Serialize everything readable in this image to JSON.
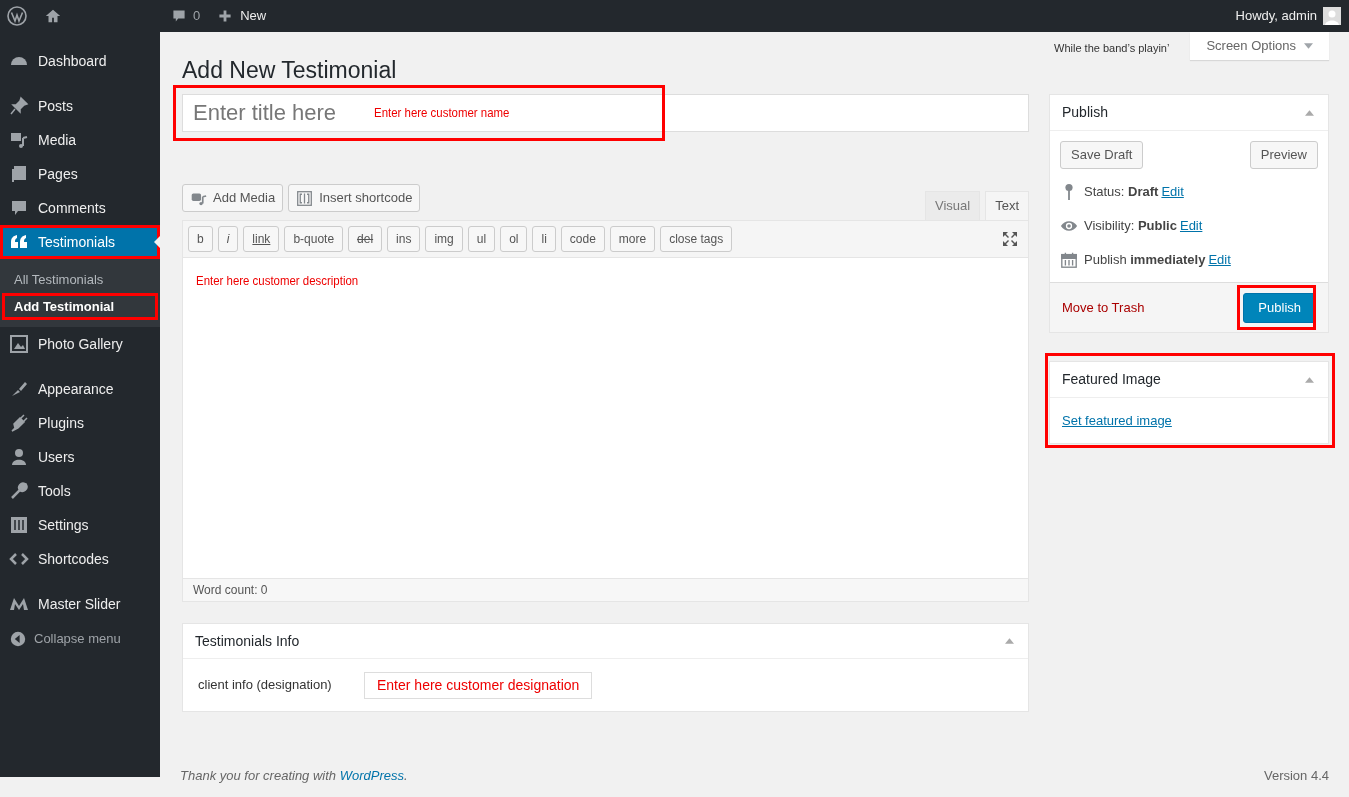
{
  "admin_bar": {
    "comments_count": "0",
    "new_label": "New",
    "greeting": "Howdy, admin"
  },
  "sidebar": {
    "groups": [
      [
        {
          "label": "Dashboard",
          "selected": false,
          "annotated": false
        }
      ],
      [
        {
          "label": "Posts",
          "selected": false,
          "annotated": false
        },
        {
          "label": "Media",
          "selected": false,
          "annotated": false
        },
        {
          "label": "Pages",
          "selected": false,
          "annotated": false
        },
        {
          "label": "Comments",
          "selected": false,
          "annotated": false
        },
        {
          "label": "Testimonials",
          "selected": true,
          "annotated": true,
          "children": [
            {
              "label": "All Testimonials",
              "selected": false,
              "annotated": false
            },
            {
              "label": "Add Testimonial",
              "selected": true,
              "annotated": true
            }
          ]
        },
        {
          "label": "Photo Gallery",
          "selected": false,
          "annotated": false
        }
      ],
      [
        {
          "label": "Appearance",
          "selected": false,
          "annotated": false
        },
        {
          "label": "Plugins",
          "selected": false,
          "annotated": false
        },
        {
          "label": "Users",
          "selected": false,
          "annotated": false
        },
        {
          "label": "Tools",
          "selected": false,
          "annotated": false
        },
        {
          "label": "Settings",
          "selected": false,
          "annotated": false
        },
        {
          "label": "Shortcodes",
          "selected": false,
          "annotated": false
        }
      ],
      [
        {
          "label": "Master Slider",
          "selected": false,
          "annotated": false
        }
      ]
    ],
    "collapse": "Collapse menu"
  },
  "header": {
    "tagline": "While the band’s playin’",
    "screen_options": "Screen Options",
    "page_title": "Add New Testimonial"
  },
  "title_field": {
    "placeholder": "Enter title here",
    "annotation": "Enter here customer name",
    "annotated": true
  },
  "media_buttons": [
    "Add Media",
    "Insert shortcode"
  ],
  "editor_tabs": [
    {
      "label": "Visual",
      "selected": false
    },
    {
      "label": "Text",
      "selected": true
    }
  ],
  "quicktags": [
    {
      "label": "b",
      "kind": "plain"
    },
    {
      "label": "i",
      "kind": "italic"
    },
    {
      "label": "link",
      "kind": "underline"
    },
    {
      "label": "b-quote",
      "kind": "plain"
    },
    {
      "label": "del",
      "kind": "strike"
    },
    {
      "label": "ins",
      "kind": "plain"
    },
    {
      "label": "img",
      "kind": "plain"
    },
    {
      "label": "ul",
      "kind": "plain"
    },
    {
      "label": "ol",
      "kind": "plain"
    },
    {
      "label": "li",
      "kind": "plain"
    },
    {
      "label": "code",
      "kind": "plain"
    },
    {
      "label": "more",
      "kind": "plain"
    },
    {
      "label": "close tags",
      "kind": "plain"
    }
  ],
  "editor": {
    "annotation": "Enter here customer description",
    "word_count": "Word count: 0"
  },
  "testimonials_info": {
    "title": "Testimonials Info",
    "field_label": "client info (designation)",
    "annotation": "Enter here customer designation"
  },
  "publish_box": {
    "title": "Publish",
    "save_draft": "Save Draft",
    "preview": "Preview",
    "rows": [
      "Status: **Draft**",
      "Visibility: **Public**",
      "Publish **immediately**"
    ],
    "row_links": [
      "Edit",
      "Edit",
      "Edit"
    ],
    "trash": "Move to Trash",
    "publish_button": "Publish",
    "publish_annotated": true
  },
  "featured_image": {
    "title": "Featured Image",
    "link": "Set featured image",
    "annotated": true
  },
  "footer": {
    "thanks": "Thank you for creating with",
    "link": "WordPress",
    "suffix": ".",
    "version": "Version 4.4"
  }
}
